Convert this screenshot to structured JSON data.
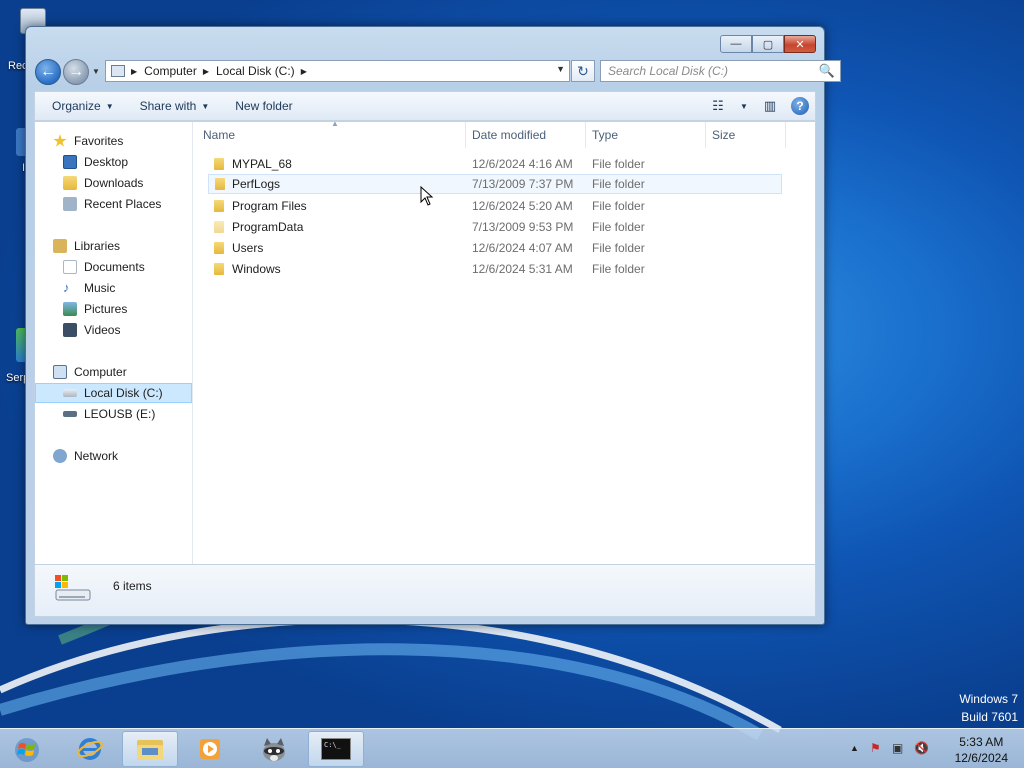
{
  "desktop": {
    "icons": [
      {
        "label": "Rec",
        "name": "recycle-bin"
      },
      {
        "label": "I",
        "name": "shortcut-icon"
      },
      {
        "label": "Serp",
        "name": "serpent-shortcut"
      }
    ],
    "watermark": {
      "line1": "Windows 7",
      "line2": "Build 7601"
    }
  },
  "window": {
    "caption_buttons": {
      "minimize": "—",
      "maximize": "▢",
      "close": "✕"
    },
    "breadcrumb": [
      "Computer",
      "Local Disk (C:)"
    ],
    "search_placeholder": "Search Local Disk (C:)",
    "toolbar": {
      "organize": "Organize",
      "share_with": "Share with",
      "new_folder": "New folder"
    },
    "nav": {
      "favorites": "Favorites",
      "desktop": "Desktop",
      "downloads": "Downloads",
      "recent_places": "Recent Places",
      "libraries": "Libraries",
      "documents": "Documents",
      "music": "Music",
      "pictures": "Pictures",
      "videos": "Videos",
      "computer": "Computer",
      "local_disk": "Local Disk (C:)",
      "leousb": "LEOUSB (E:)",
      "network": "Network"
    },
    "columns": {
      "name": "Name",
      "date_modified": "Date modified",
      "type": "Type",
      "size": "Size"
    },
    "files": [
      {
        "name": "MYPAL_68",
        "date": "12/6/2024 4:16 AM",
        "type": "File folder"
      },
      {
        "name": "PerfLogs",
        "date": "7/13/2009 7:37 PM",
        "type": "File folder"
      },
      {
        "name": "Program Files",
        "date": "12/6/2024 5:20 AM",
        "type": "File folder"
      },
      {
        "name": "ProgramData",
        "date": "7/13/2009 9:53 PM",
        "type": "File folder"
      },
      {
        "name": "Users",
        "date": "12/6/2024 4:07 AM",
        "type": "File folder"
      },
      {
        "name": "Windows",
        "date": "12/6/2024 5:31 AM",
        "type": "File folder"
      }
    ],
    "status": {
      "item_count": "6 items"
    }
  },
  "taskbar": {
    "clock": {
      "time": "5:33 AM",
      "date": "12/6/2024"
    },
    "cmd_label": "C:\\_"
  }
}
